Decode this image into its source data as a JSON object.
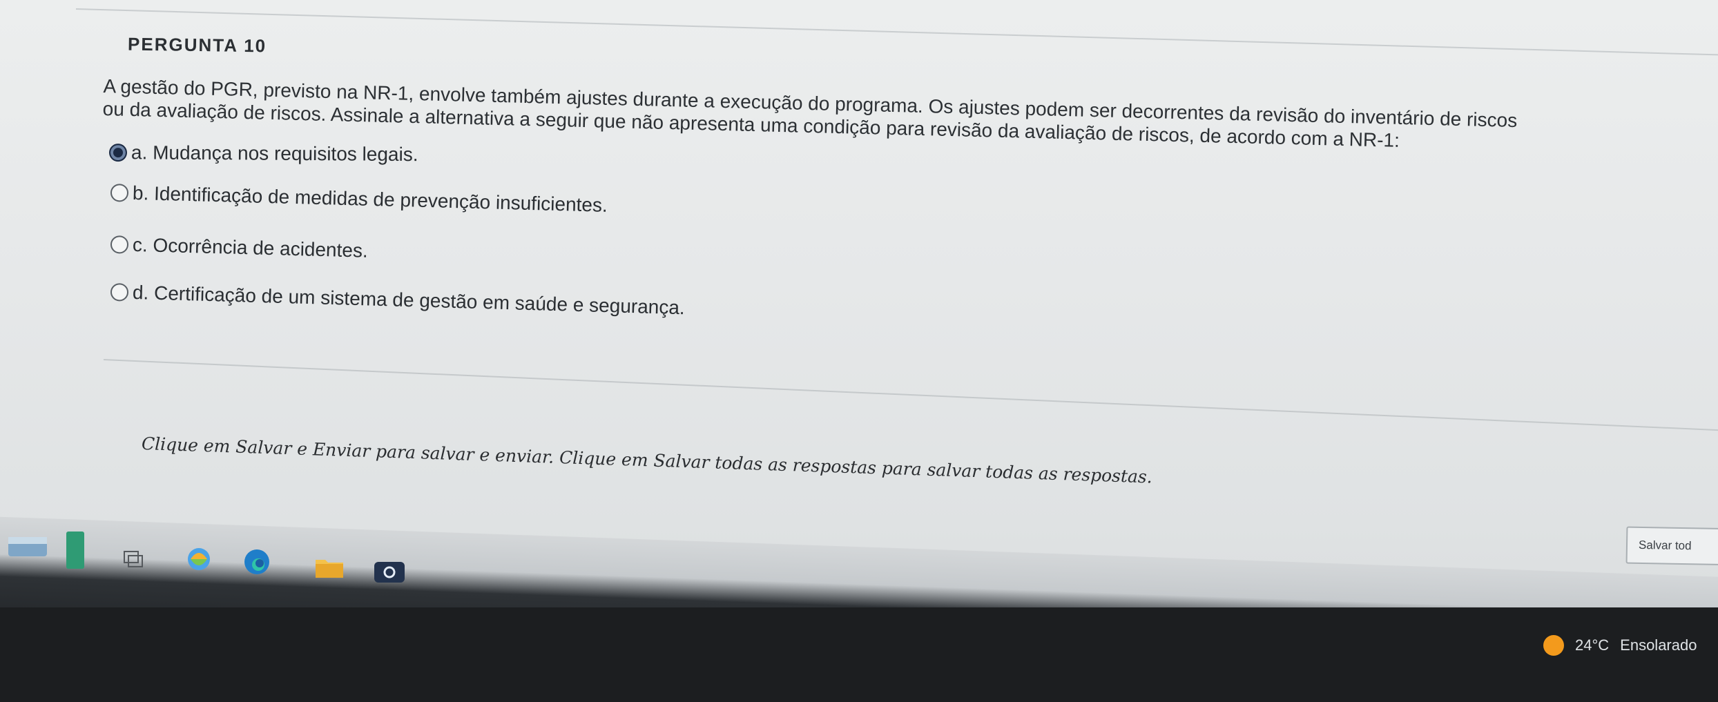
{
  "question": {
    "title": "PERGUNTA 10",
    "text": "A gestão do PGR, previsto na NR-1, envolve também ajustes durante a execução do programa. Os ajustes podem ser decorrentes da revisão do inventário de riscos ou da avaliação de riscos. Assinale a alternativa a seguir que não apresenta uma condição para revisão da avaliação de riscos, de acordo com a NR-1:",
    "options": [
      {
        "label": "a. Mudança nos requisitos legais.",
        "selected": true
      },
      {
        "label": "b. Identificação de medidas de prevenção insuficientes.",
        "selected": false
      },
      {
        "label": "c. Ocorrência de acidentes.",
        "selected": false
      },
      {
        "label": "d. Certificação de um sistema de gestão em saúde e segurança.",
        "selected": false
      }
    ]
  },
  "footer": {
    "instruction": "Clique em Salvar e Enviar para salvar e enviar. Clique em Salvar todas as respostas para salvar todas as respostas.",
    "save_all_label": "Salvar tod"
  },
  "taskbar": {
    "icons": [
      "widgets-icon",
      "file-explorer-icon",
      "copilot-icon",
      "edge-icon",
      "folder-icon",
      "app-icon"
    ],
    "weather": {
      "temperature": "24°C",
      "condition": "Ensolarado"
    }
  },
  "colors": {
    "radio_selected": "#1b2a44",
    "weather_sun": "#f39a1c"
  }
}
